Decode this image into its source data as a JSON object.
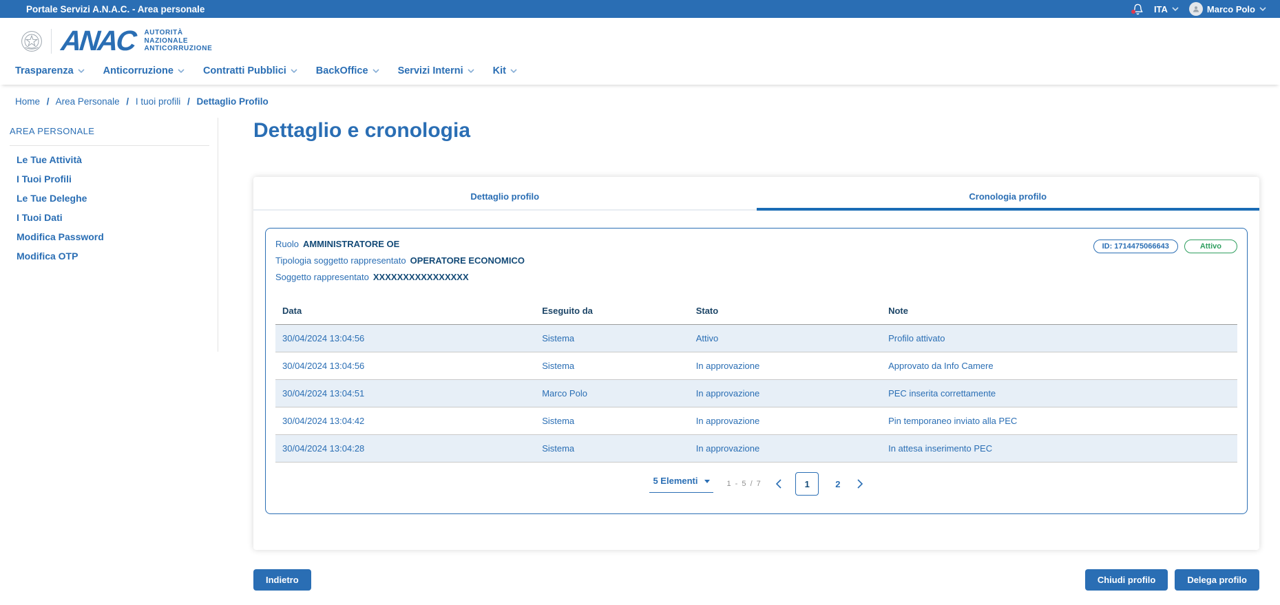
{
  "colors": {
    "primary_blue": "#2a6eb4",
    "active_tab_blue": "#1a6cb5",
    "dark_blue_text": "#1c4567",
    "active_green": "#2e9e5e",
    "notification_red": "#e0394d",
    "row_alt_blue": "#e7eff7"
  },
  "topbar": {
    "title": "Portale Servizi A.N.A.C. - Area personale",
    "language": "ITA",
    "user_name": "Marco Polo"
  },
  "header": {
    "logo_acronym": "ANAC",
    "logo_lines": [
      "AUTORITÀ",
      "NAZIONALE",
      "ANTICORRUZIONE"
    ],
    "nav": [
      "Trasparenza",
      "Anticorruzione",
      "Contratti Pubblici",
      "BackOffice",
      "Servizi Interni",
      "Kit"
    ]
  },
  "breadcrumb": {
    "separator": "/",
    "items": [
      "Home",
      "Area Personale",
      "I tuoi profili",
      "Dettaglio Profilo"
    ]
  },
  "sidebar": {
    "title": "AREA PERSONALE",
    "items": [
      "Le Tue Attività",
      "I Tuoi Profili",
      "Le Tue Deleghe",
      "I Tuoi Dati",
      "Modifica Password",
      "Modifica OTP"
    ]
  },
  "main": {
    "title": "Dettaglio e cronologia",
    "tabs": [
      {
        "label": "Dettaglio profilo",
        "active": false
      },
      {
        "label": "Cronologia profilo",
        "active": true
      }
    ],
    "profile": {
      "role_label": "Ruolo",
      "role_value": "AMMINISTRATORE OE",
      "subject_type_label": "Tipologia soggetto rappresentato",
      "subject_type_value": "OPERATORE ECONOMICO",
      "subject_label": "Soggetto rappresentato",
      "subject_value": "XXXXXXXXXXXXXXXX",
      "id_badge": "ID: 1714475066643",
      "status_badge": "Attivo"
    },
    "table": {
      "columns": [
        "Data",
        "Eseguito da",
        "Stato",
        "Note"
      ],
      "rows": [
        [
          "30/04/2024 13:04:56",
          "Sistema",
          "Attivo",
          "Profilo attivato"
        ],
        [
          "30/04/2024 13:04:56",
          "Sistema",
          "In approvazione",
          "Approvato da Info Camere"
        ],
        [
          "30/04/2024 13:04:51",
          "Marco Polo",
          "In approvazione",
          "PEC inserita correttamente"
        ],
        [
          "30/04/2024 13:04:42",
          "Sistema",
          "In approvazione",
          "Pin temporaneo inviato alla PEC"
        ],
        [
          "30/04/2024 13:04:28",
          "Sistema",
          "In approvazione",
          "In attesa inserimento PEC"
        ]
      ]
    },
    "pagination": {
      "page_size": "5 Elementi",
      "range": "1 - 5 / 7",
      "pages": [
        "1",
        "2"
      ],
      "current_page": "1"
    },
    "actions": {
      "back": "Indietro",
      "close_profile": "Chiudi profilo",
      "delegate_profile": "Delega profilo"
    }
  }
}
